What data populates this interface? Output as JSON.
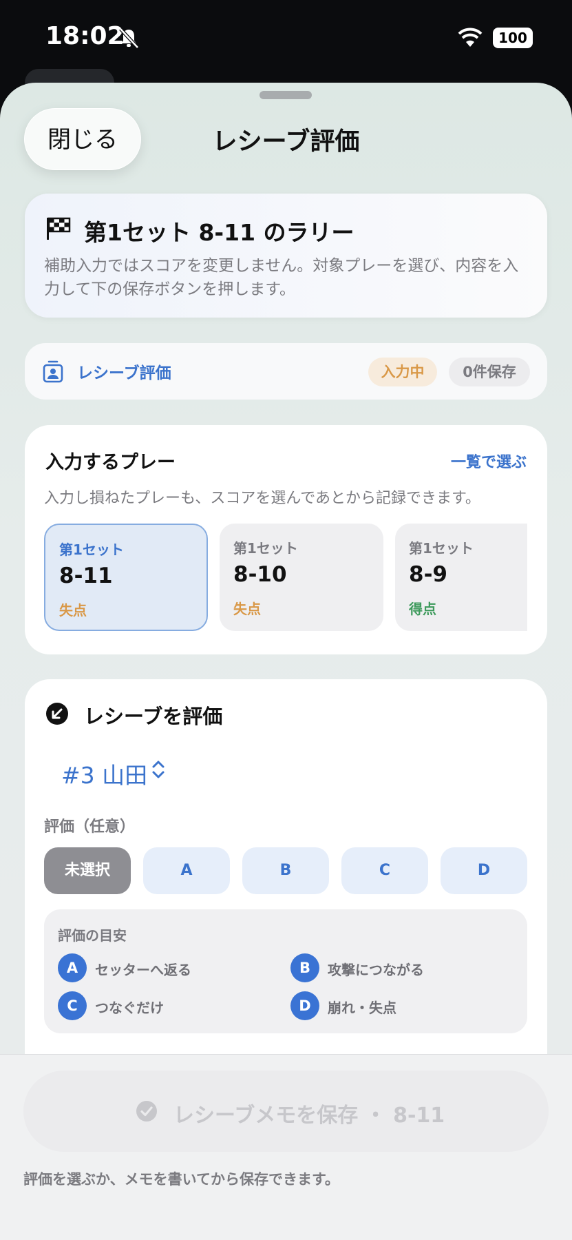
{
  "status": {
    "time": "18:02",
    "battery": "100"
  },
  "header": {
    "close_label": "閉じる",
    "title": "レシーブ評価"
  },
  "rally": {
    "title": "第1セット 8-11 のラリー",
    "description": "補助入力ではスコアを変更しません。対象プレーを選び、内容を入力して下の保存ボタンを押します。"
  },
  "receive_status": {
    "label": "レシーブ評価",
    "badge_active": "入力中",
    "badge_saved": "0件保存"
  },
  "plays": {
    "title": "入力するプレー",
    "link": "一覧で選ぶ",
    "description": "入力し損ねたプレーも、スコアを選んであとから記録できます。",
    "items": [
      {
        "set": "第1セット",
        "score": "8-11",
        "result": "失点",
        "kind": "loss",
        "selected": true
      },
      {
        "set": "第1セット",
        "score": "8-10",
        "result": "失点",
        "kind": "loss",
        "selected": false
      },
      {
        "set": "第1セット",
        "score": "8-9",
        "result": "得点",
        "kind": "win",
        "selected": false
      }
    ]
  },
  "evaluation": {
    "title": "レシーブを評価",
    "player": "#3 山田",
    "rating_label": "評価（任意）",
    "ratings": [
      "未選択",
      "A",
      "B",
      "C",
      "D"
    ],
    "guide_title": "評価の目安",
    "guide": [
      {
        "grade": "A",
        "text": "セッターへ返る"
      },
      {
        "grade": "B",
        "text": "攻撃につながる"
      },
      {
        "grade": "C",
        "text": "つなぐだけ"
      },
      {
        "grade": "D",
        "text": "崩れ・失点"
      }
    ]
  },
  "footer": {
    "save_label": "レシーブメモを保存 ・ 8-11",
    "hint": "評価を選ぶか、メモを書いてから保存できます。"
  },
  "colors": {
    "accent": "#3b73cc",
    "loss": "#d99847",
    "win": "#3e9a5c",
    "badge_active_bg": "#f7ebdc"
  }
}
